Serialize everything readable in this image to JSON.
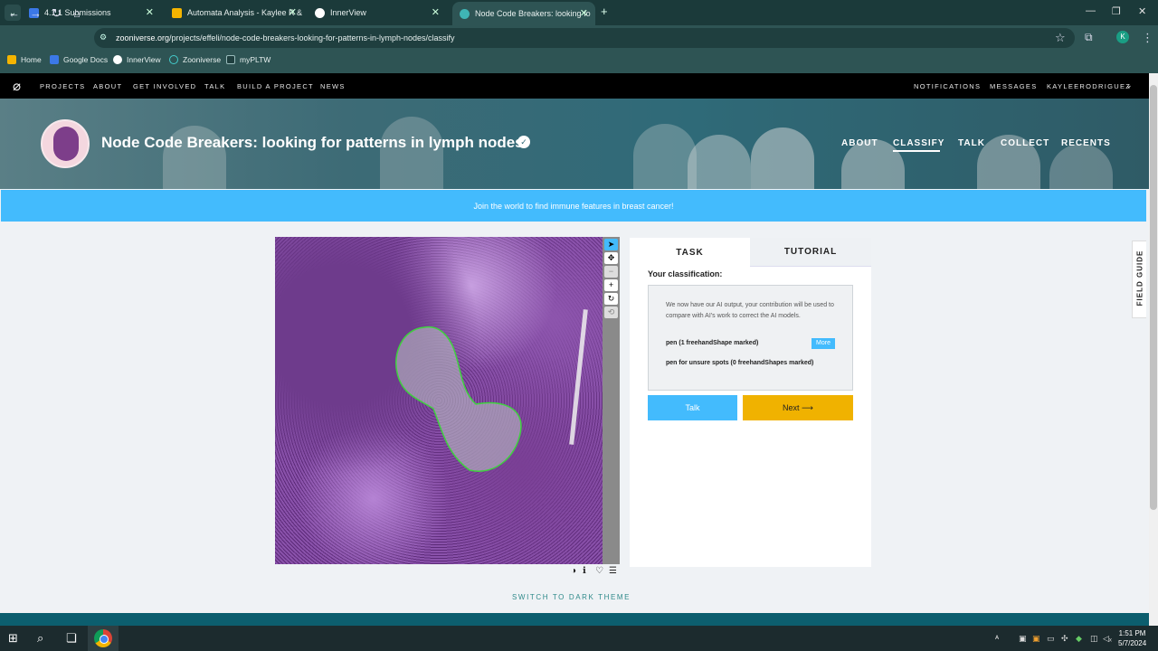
{
  "browser": {
    "tabs": [
      {
        "title": "4.1.1 Submissions",
        "favicon_color": "#3b78e7"
      },
      {
        "title": "Automata Analysis - Kaylee R &",
        "favicon_color": "#f4b400"
      },
      {
        "title": "InnerView",
        "favicon_color": "#ffffff"
      },
      {
        "title": "Node Code Breakers: looking fo",
        "favicon_color": "#3fb5b5"
      }
    ],
    "url_domain": "zooniverse.org",
    "url_path": "/projects/effeli/node-code-breakers-looking-for-patterns-in-lymph-nodes/classify",
    "profile_initial": "K",
    "bookmarks": [
      "Home",
      "Google Docs",
      "InnerView",
      "Zooniverse",
      "myPLTW"
    ]
  },
  "zooniverse_nav": {
    "left": [
      "PROJECTS",
      "ABOUT",
      "GET INVOLVED",
      "TALK",
      "BUILD A PROJECT",
      "NEWS"
    ],
    "right": [
      "NOTIFICATIONS",
      "MESSAGES",
      "KAYLEERODRIGUEZ"
    ]
  },
  "project": {
    "title": "Node Code Breakers: looking for patterns in lymph nodes",
    "nav": [
      "ABOUT",
      "CLASSIFY",
      "TALK",
      "COLLECT",
      "RECENTS"
    ],
    "active_nav": "CLASSIFY"
  },
  "banner": "Join the world to find immune features in breast cancer!",
  "task_panel": {
    "tabs": [
      "TASK",
      "TUTORIAL"
    ],
    "heading": "Your classification:",
    "instructions": "We now have our AI output, your contribution will be used to compare with AI's work to correct the AI models.",
    "tool1": "pen (1 freehandShape marked)",
    "more_label": "More",
    "tool2": "pen for unsure spots (0 freehandShapes marked)",
    "talk_label": "Talk",
    "next_label": "Next ⟶"
  },
  "field_guide_label": "FIELD GUIDE",
  "dark_theme_label": "SWITCH TO DARK THEME",
  "taskbar": {
    "time": "1:51 PM",
    "date": "5/7/2024"
  },
  "colors": {
    "accent_blue": "#43bbfd",
    "next_yellow": "#f0b200",
    "chrome_dark": "#1b3a3a",
    "outline_green": "#3fd13f"
  }
}
